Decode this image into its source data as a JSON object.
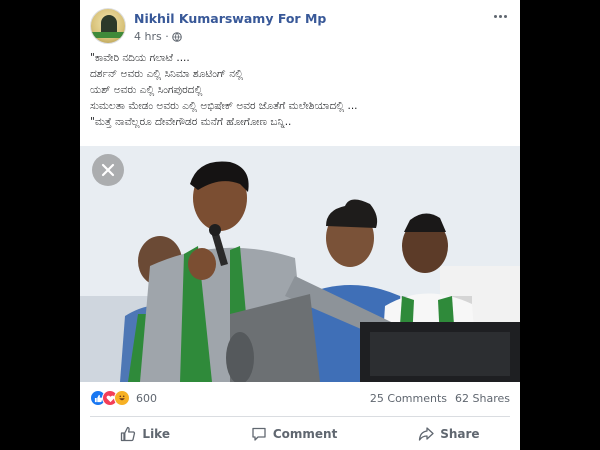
{
  "post": {
    "page_name": "Nikhil Kumarswamy For Mp",
    "time": "4 hrs ·",
    "caption": [
      "\"ಕಾವೇರಿ ನದಿಯ ಗಲಾಟೆ ....",
      "ದರ್ಶನ್ ಅವರು ಎಲ್ಲಿ ಸಿನಿಮಾ ಶೂಟಿಂಗ್ ನಲ್ಲಿ",
      "ಯಶ್ ಅವರು ಎಲ್ಲಿ ಸಿಂಗಪುರದಲ್ಲಿ",
      "ಸುಮಲತಾ ಮೇಡಂ ಅವರು ಎಲ್ಲಿ ಅಭಿಷೇಕ್ ಅವರ ಜೊತೆಗೆ ಮಲೇಶಿಯಾದಲ್ಲಿ ...",
      "\"ಮತ್ತೆ ನಾವೆಲ್ಲರೂ ದೇವೇಗೌಡರ ಮನೆಗೆ ಹೋಗೋಣ ಬನ್ನಿ.."
    ],
    "reaction_count": "600",
    "comments": "25 Comments",
    "shares": "62 Shares"
  },
  "actions": {
    "like": "Like",
    "comment": "Comment",
    "share": "Share"
  },
  "icons": {
    "globe": "globe-icon",
    "more": "more-icon",
    "close": "close-icon",
    "like": "thumbs-up-icon",
    "comment": "comment-icon",
    "share": "share-icon"
  },
  "colors": {
    "page_name": "#385898",
    "meta": "#606770",
    "like_reaction": "#1877f2",
    "love_reaction": "#f33e58",
    "haha_reaction": "#f7b125",
    "scarf_green": "#2f8a3a"
  }
}
